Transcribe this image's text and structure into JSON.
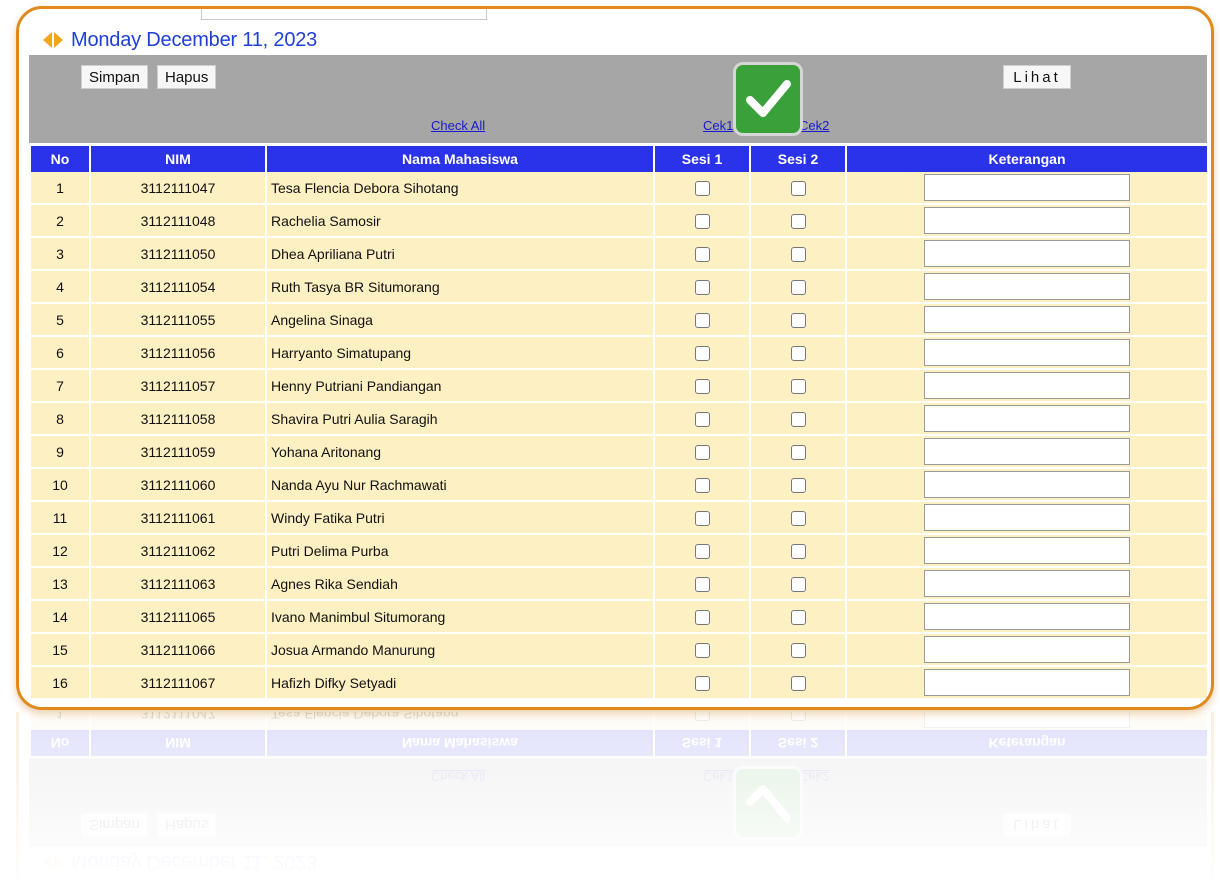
{
  "date_header": {
    "text": "Monday December 11, 2023"
  },
  "toolbar": {
    "simpan_label": "Simpan",
    "hapus_label": "Hapus",
    "lihat_label": "Lihat"
  },
  "links": {
    "check_all": "Check All",
    "cek1": "Cek1",
    "cek2": "Cek2"
  },
  "table": {
    "columns": [
      "No",
      "NIM",
      "Nama Mahasiswa",
      "Sesi 1",
      "Sesi 2",
      "Keterangan"
    ],
    "rows": [
      {
        "no": "1",
        "nim": "3112111047",
        "nama": "Tesa Flencia Debora Sihotang"
      },
      {
        "no": "2",
        "nim": "3112111048",
        "nama": "Rachelia Samosir"
      },
      {
        "no": "3",
        "nim": "3112111050",
        "nama": "Dhea Apriliana Putri"
      },
      {
        "no": "4",
        "nim": "3112111054",
        "nama": "Ruth Tasya BR Situmorang"
      },
      {
        "no": "5",
        "nim": "3112111055",
        "nama": "Angelina Sinaga"
      },
      {
        "no": "6",
        "nim": "3112111056",
        "nama": "Harryanto Simatupang"
      },
      {
        "no": "7",
        "nim": "3112111057",
        "nama": "Henny Putriani Pandiangan"
      },
      {
        "no": "8",
        "nim": "3112111058",
        "nama": "Shavira Putri Aulia Saragih"
      },
      {
        "no": "9",
        "nim": "3112111059",
        "nama": "Yohana Aritonang"
      },
      {
        "no": "10",
        "nim": "3112111060",
        "nama": "Nanda Ayu Nur Rachmawati"
      },
      {
        "no": "11",
        "nim": "3112111061",
        "nama": "Windy Fatika Putri"
      },
      {
        "no": "12",
        "nim": "3112111062",
        "nama": "Putri Delima Purba"
      },
      {
        "no": "13",
        "nim": "3112111063",
        "nama": "Agnes Rika Sendiah"
      },
      {
        "no": "14",
        "nim": "3112111065",
        "nama": "Ivano Manimbul Situmorang"
      },
      {
        "no": "15",
        "nim": "3112111066",
        "nama": "Josua Armando Manurung"
      },
      {
        "no": "16",
        "nim": "3112111067",
        "nama": "Hafizh Difky Setyadi"
      }
    ]
  },
  "colors": {
    "frame": "#e08a1e",
    "header": "#2a33ea",
    "row": "#fdf0c2",
    "toolbar": "#a6a6a6",
    "link": "#1a1acc",
    "check_badge": "#3aa13a"
  },
  "icons": {
    "nav": "left-right-arrows-icon",
    "badge": "green-check-icon"
  }
}
